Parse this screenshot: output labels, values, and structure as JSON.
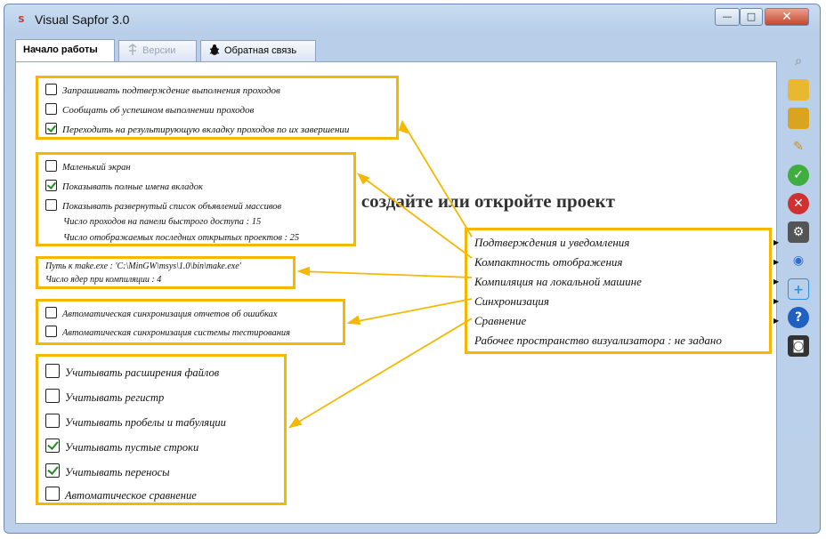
{
  "window": {
    "title": "Visual Sapfor 3.0",
    "app_icon": "sapfor-icon"
  },
  "tabs": [
    {
      "label": "Начало работы",
      "icon": "",
      "active": true
    },
    {
      "label": "Версии",
      "icon": "versions-icon",
      "active": false
    },
    {
      "label": "Обратная связь",
      "icon": "bug-icon",
      "active": false
    }
  ],
  "main": {
    "background_text": "y, создайте или откройте проект"
  },
  "groups": {
    "confirmations": [
      {
        "label": "Запрашивать подтверждение выполнения проходов",
        "checked": false
      },
      {
        "label": "Сообщать об успешном выполнении проходов",
        "checked": false
      },
      {
        "label": "Переходить на результирующую вкладку проходов по их завершении",
        "checked": true
      }
    ],
    "compact": {
      "checks": [
        {
          "label": "Маленький экран",
          "checked": false
        },
        {
          "label": "Показывать полные имена вкладок",
          "checked": true
        },
        {
          "label": "Показывать развернутый список объявлений массивов",
          "checked": false
        }
      ],
      "info": [
        "Число проходов на панели быстрого доступа : 15",
        "Число отображаемых последних открытых проектов : 25"
      ]
    },
    "local": [
      "Путь к make.exe : 'C:\\MinGW\\msys\\1.0\\bin\\make.exe'",
      "Число ядер при компиляции : 4"
    ],
    "sync": [
      {
        "label": "Автоматическая синхронизация отчетов об ошибках",
        "checked": false
      },
      {
        "label": "Автоматическая синхронизация системы тестирования",
        "checked": false
      }
    ],
    "compare": [
      {
        "label": "Учитывать расширения файлов",
        "checked": false
      },
      {
        "label": "Учитывать регистр",
        "checked": false
      },
      {
        "label": "Учитывать пробелы и табуляции",
        "checked": false
      },
      {
        "label": "Учитывать пустые строки",
        "checked": true
      },
      {
        "label": "Учитывать переносы",
        "checked": true
      },
      {
        "label": "Автоматическое сравнение",
        "checked": false
      }
    ]
  },
  "menu": {
    "items": [
      {
        "label": "Подтверждения и уведомления",
        "submenu": true
      },
      {
        "label": "Компактность отображения",
        "submenu": true
      },
      {
        "label": "Компиляция на локальной машине",
        "submenu": true
      },
      {
        "label": "Синхронизация",
        "submenu": true
      },
      {
        "label": "Сравнение",
        "submenu": true
      },
      {
        "label": "Рабочее пространство визуализатора : не задано",
        "submenu": false
      }
    ]
  },
  "toolbar": {
    "buttons": [
      {
        "name": "search-folder-icon",
        "glyph": "⌕",
        "color": "#9aa5b3"
      },
      {
        "name": "open-folder-icon",
        "glyph": "▰",
        "color": "#e8b830"
      },
      {
        "name": "import-folder-icon",
        "glyph": "▰",
        "color": "#d9a520"
      },
      {
        "name": "clean-brush-icon",
        "glyph": "✎",
        "color": "#c89028"
      },
      {
        "name": "accept-green-icon",
        "glyph": "✓",
        "color": "#3fae3f"
      },
      {
        "name": "close-red-icon",
        "glyph": "✕",
        "color": "#d03030"
      },
      {
        "name": "settings-gear-icon",
        "glyph": "⚙",
        "color": "#555555"
      },
      {
        "name": "broadcast-icon",
        "glyph": "◉",
        "color": "#2f6fd0"
      },
      {
        "name": "copy-add-icon",
        "glyph": "⊕",
        "color": "#2f8fe0"
      },
      {
        "name": "help-icon",
        "glyph": "?",
        "color": "#2060c0"
      },
      {
        "name": "camera-icon",
        "glyph": "◙",
        "color": "#333333"
      }
    ]
  },
  "colors": {
    "highlight": "#f5b800",
    "check": "#1f8f1f"
  }
}
